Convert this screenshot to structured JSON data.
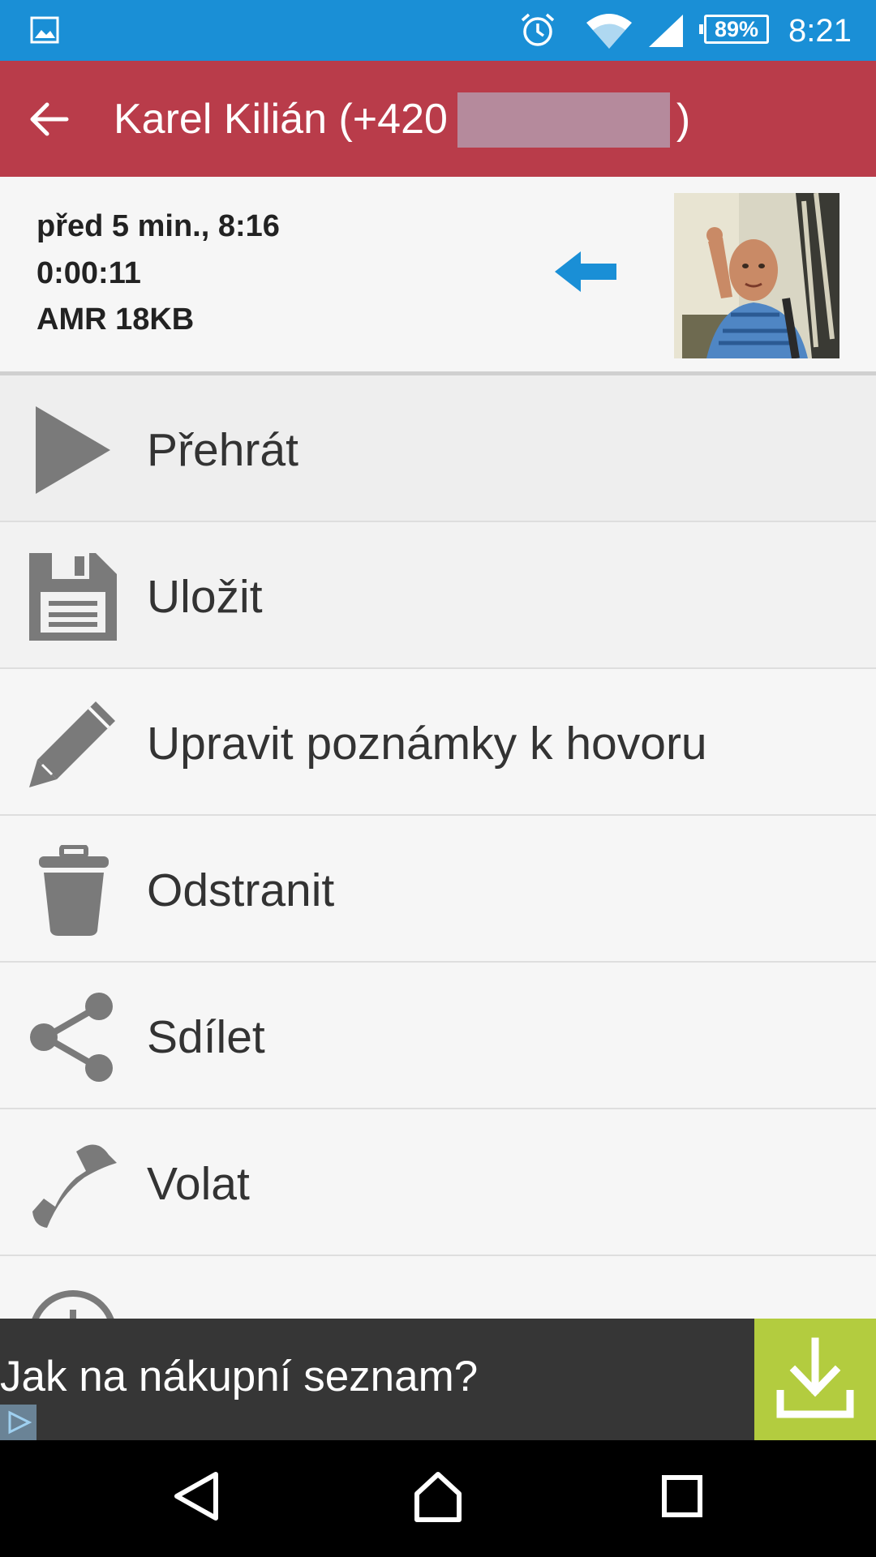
{
  "status_bar": {
    "battery": "89%",
    "time": "8:21",
    "icons": [
      "gallery-icon",
      "alarm-icon",
      "wifi-icon",
      "signal-icon",
      "battery-icon"
    ]
  },
  "app_bar": {
    "title": "Karel Kilián (+420",
    "title_end": ")",
    "back_icon": "arrow-left-icon"
  },
  "recording": {
    "when": "před 5 min., 8:16",
    "duration": "0:00:11",
    "format_size": "AMR 18KB",
    "direction_icon": "incoming-arrow-icon",
    "direction_color": "#1a8fd6"
  },
  "menu": [
    {
      "label": "Přehrát",
      "icon": "play-icon"
    },
    {
      "label": "Uložit",
      "icon": "save-icon"
    },
    {
      "label": "Upravit poznámky k hovoru",
      "icon": "pencil-icon"
    },
    {
      "label": "Odstranit",
      "icon": "trash-icon"
    },
    {
      "label": "Sdílet",
      "icon": "share-icon"
    },
    {
      "label": "Volat",
      "icon": "phone-icon"
    }
  ],
  "ad": {
    "text": "Jak na nákupní seznam?",
    "button_icon": "download-icon",
    "button_color": "#b3cc3f"
  },
  "colors": {
    "status_bar": "#1a8fd6",
    "app_bar": "#b93c4a",
    "icon_gray": "#7a7a7a"
  }
}
